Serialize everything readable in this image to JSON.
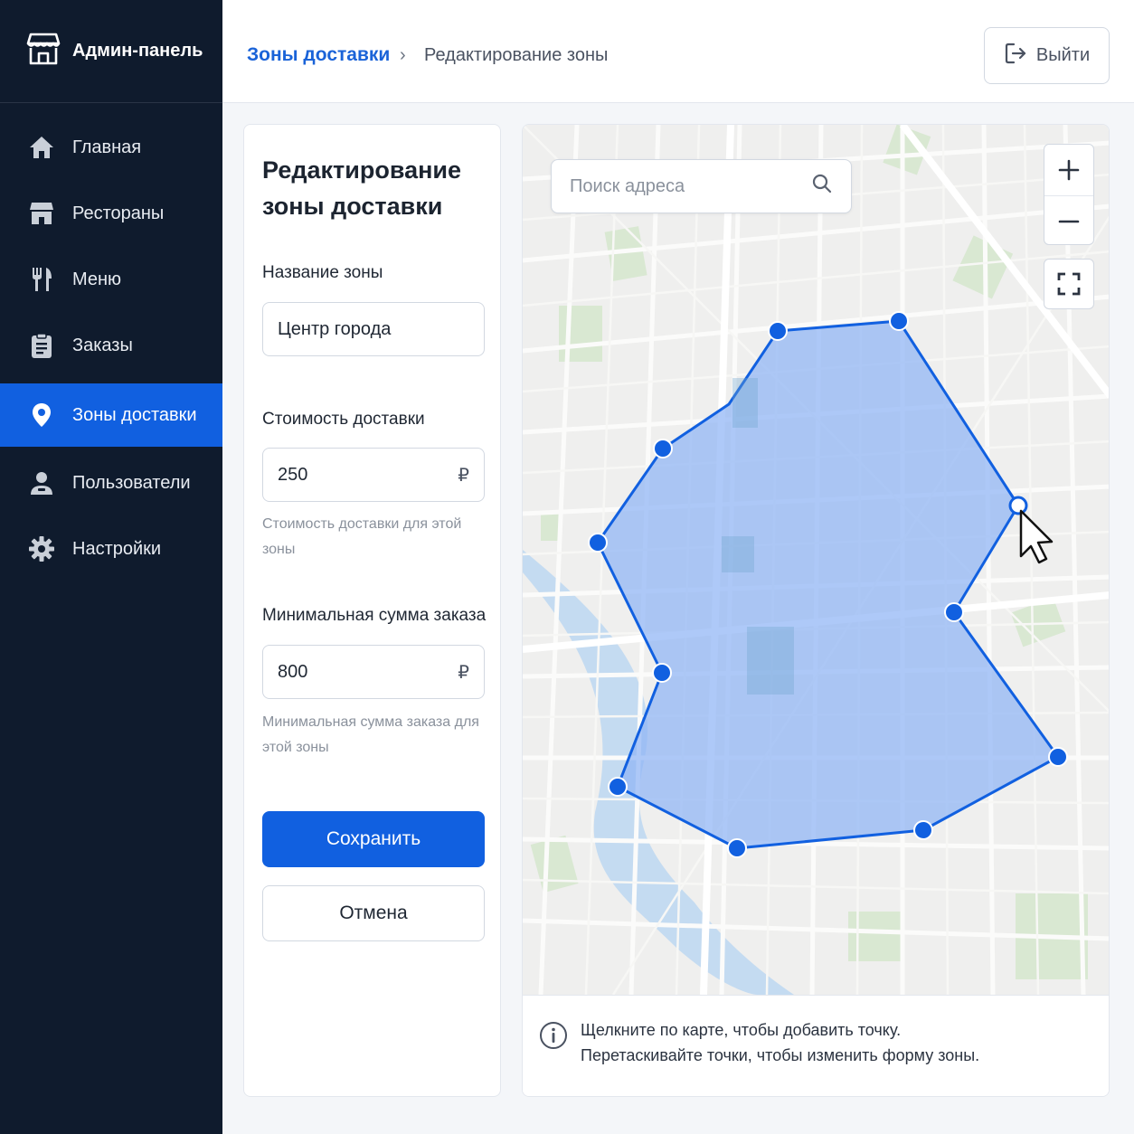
{
  "app": {
    "title": "Админ-панель",
    "icon": "store-icon"
  },
  "sidebar": {
    "items": [
      {
        "label": "Главная",
        "icon": "home-icon",
        "active": false
      },
      {
        "label": "Рестораны",
        "icon": "store-icon",
        "active": false
      },
      {
        "label": "Меню",
        "icon": "fork-knife-icon",
        "active": false
      },
      {
        "label": "Заказы",
        "icon": "clipboard-icon",
        "active": false
      },
      {
        "label": "Зоны доставки",
        "icon": "map-pin-icon",
        "active": true
      },
      {
        "label": "Пользователи",
        "icon": "user-icon",
        "active": false
      },
      {
        "label": "Настройки",
        "icon": "gear-icon",
        "active": false
      }
    ]
  },
  "header": {
    "breadcrumb": {
      "parent": "Зоны доставки",
      "separator": "›",
      "current": "Редактирование зоны"
    },
    "logout_label": "Выйти"
  },
  "form": {
    "title": "Редактирование зоны доставки",
    "zone_name": {
      "label": "Название зоны",
      "value": "Центр города"
    },
    "delivery_cost": {
      "label": "Стоимость доставки",
      "value": "250",
      "currency": "₽",
      "hint": "Стоимость доставки для этой зоны"
    },
    "min_order": {
      "label": "Минимальная сумма заказа",
      "value": "800",
      "currency": "₽",
      "hint": "Минимальная сумма заказа для этой зоны"
    },
    "save_label": "Сохранить",
    "cancel_label": "Отмена"
  },
  "map": {
    "search_placeholder": "Поиск адреса",
    "zoom_in": "+",
    "zoom_out": "−",
    "info_lines": [
      "Щелкните по карте, чтобы добавить точку.",
      "Перетаскивайте точки, чтобы изменить форму зоны."
    ],
    "zone_fill_color": "#8fb4f5",
    "zone_stroke_color": "#1160e0"
  },
  "colors": {
    "accent": "#1160e0",
    "sidebar_bg": "#0f1b2d"
  }
}
